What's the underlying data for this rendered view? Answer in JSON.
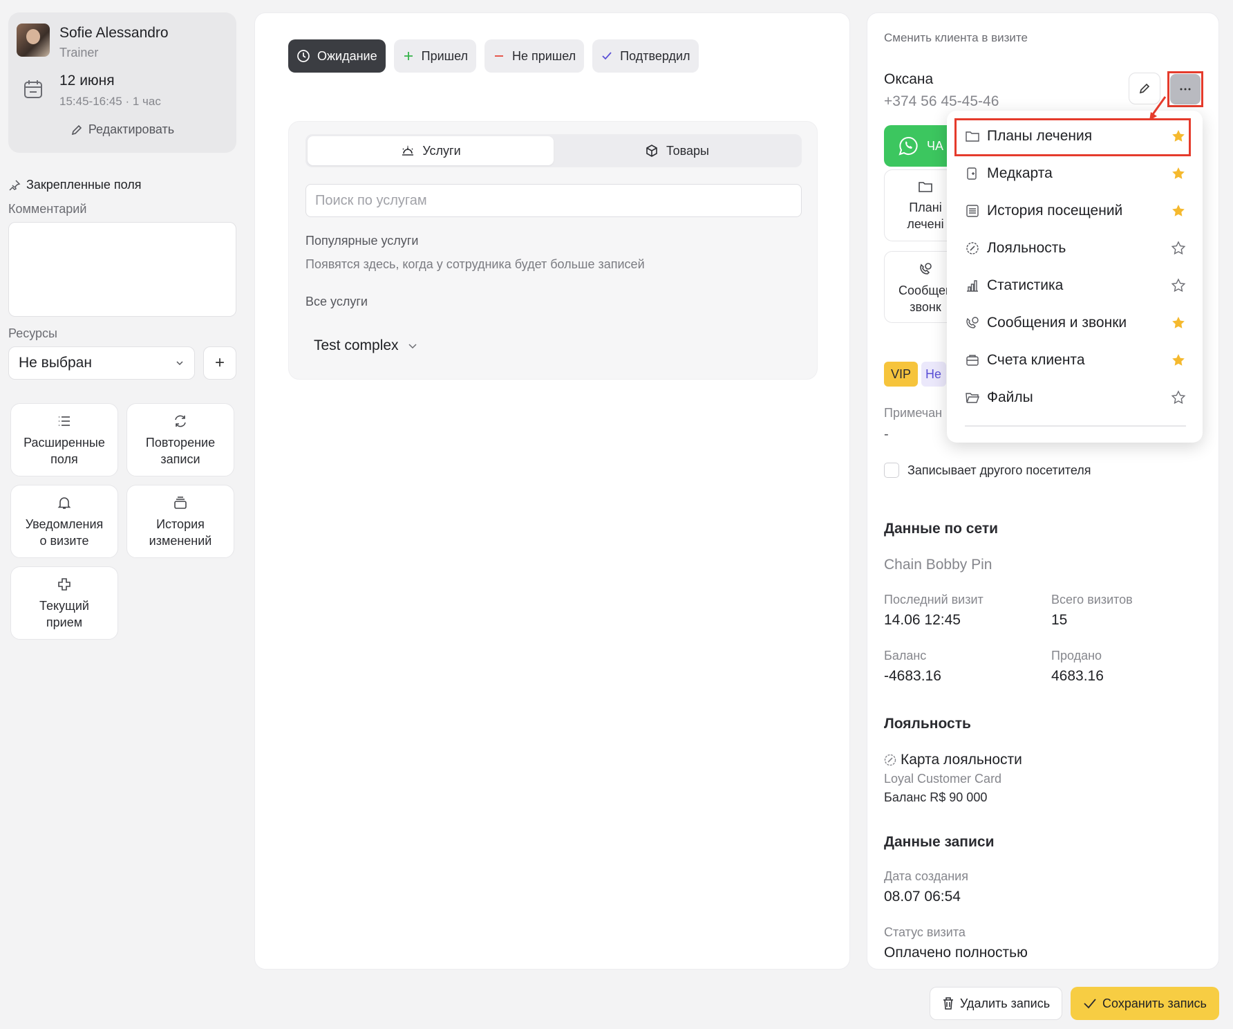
{
  "staff": {
    "name": "Sofie Alessandro",
    "role": "Trainer",
    "date": "12 июня",
    "time": "15:45-16:45 · 1 час",
    "edit_label": "Редактировать"
  },
  "pinned": {
    "title": "Закрепленные поля",
    "comment_label": "Комментарий",
    "comment_value": "",
    "resources_label": "Ресурсы",
    "resources_value": "Не выбран",
    "add_label": "+"
  },
  "tiles": [
    {
      "label": "Расширенные\nполя",
      "icon": "list-icon"
    },
    {
      "label": "Повторение\nзаписи",
      "icon": "repeat-icon"
    },
    {
      "label": "Уведомления\nо визите",
      "icon": "bell-icon"
    },
    {
      "label": "История\nизменений",
      "icon": "history-icon"
    },
    {
      "label": "Текущий\nприем",
      "icon": "medical-cross-icon"
    }
  ],
  "status_buttons": [
    {
      "label": "Ожидание",
      "icon": "clock-icon",
      "active": true
    },
    {
      "label": "Пришел",
      "icon": "plus-icon",
      "color": "#35b24a"
    },
    {
      "label": "Не пришел",
      "icon": "minus-icon",
      "color": "#e5483b"
    },
    {
      "label": "Подтвердил",
      "icon": "check-icon",
      "color": "#5a4fd6"
    }
  ],
  "services": {
    "tab_services": "Услуги",
    "tab_products": "Товары",
    "search_placeholder": "Поиск по услугам",
    "popular_title": "Популярные услуги",
    "popular_hint": "Появятся здесь, когда у сотрудника будет больше записей",
    "all_title": "Все услуги",
    "group": "Test complex"
  },
  "client": {
    "change_label": "Сменить клиента в визите",
    "name": "Оксана",
    "phone": "+374 56 45-45-46",
    "whatsapp_label": "ЧА",
    "tile1": "Плані\nлечені",
    "tile2": "Сообщен\nзвонк",
    "tag_vip": "VIP",
    "tag_other": "Не",
    "note_label": "Примечан",
    "note_value": "-",
    "checkbox_label": "Записывает другого посетителя"
  },
  "network": {
    "title": "Данные по сети",
    "chain": "Chain Bobby Pin",
    "last_visit_label": "Последний визит",
    "last_visit": "14.06 12:45",
    "total_visits_label": "Всего визитов",
    "total_visits": "15",
    "balance_label": "Баланс",
    "balance": "-4683.16",
    "sold_label": "Продано",
    "sold": "4683.16"
  },
  "loyalty": {
    "title": "Лояльность",
    "card_title": "Карта лояльности",
    "card_name": "Loyal Customer Card",
    "card_balance": "Баланс R$ 90 000"
  },
  "record": {
    "title": "Данные записи",
    "created_label": "Дата создания",
    "created": "08.07 06:54",
    "status_label": "Статус визита",
    "status": "Оплачено полностью"
  },
  "dropdown": {
    "items": [
      {
        "label": "Планы лечения",
        "icon": "folder-icon",
        "starred": true
      },
      {
        "label": "Медкарта",
        "icon": "medcard-icon",
        "starred": true
      },
      {
        "label": "История посещений",
        "icon": "visits-icon",
        "starred": true
      },
      {
        "label": "Лояльность",
        "icon": "loyalty-icon",
        "starred": false
      },
      {
        "label": "Статистика",
        "icon": "stats-icon",
        "starred": false
      },
      {
        "label": "Сообщения и звонки",
        "icon": "phone-chat-icon",
        "starred": true
      },
      {
        "label": "Счета клиента",
        "icon": "wallet-icon",
        "starred": true
      },
      {
        "label": "Файлы",
        "icon": "files-icon",
        "starred": false
      }
    ],
    "star_color": "#f5b92e"
  },
  "footer": {
    "delete_label": "Удалить запись",
    "save_label": "Сохранить запись"
  },
  "colors": {
    "accent": "#f7cd43",
    "highlight": "#e53b2c",
    "whatsapp": "#3cc65f"
  }
}
